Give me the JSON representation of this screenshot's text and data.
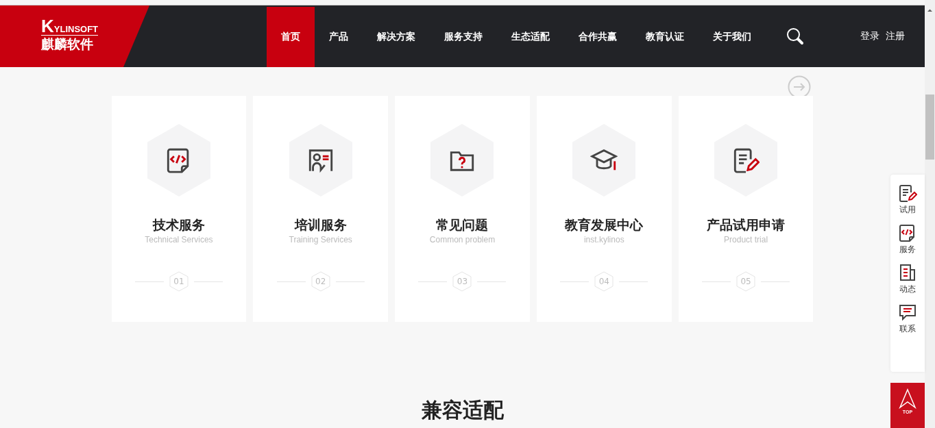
{
  "logo": {
    "wordmark": "KYLINSOFT",
    "name": "麒麟软件"
  },
  "nav": [
    {
      "label": "首页",
      "selected": true
    },
    {
      "label": "产品",
      "selected": false
    },
    {
      "label": "解决方案",
      "selected": false
    },
    {
      "label": "服务支持",
      "selected": false
    },
    {
      "label": "生态适配",
      "selected": false
    },
    {
      "label": "合作共赢",
      "selected": false
    },
    {
      "label": "教育认证",
      "selected": false
    },
    {
      "label": "关于我们",
      "selected": false
    }
  ],
  "account": [
    "登录",
    "注册"
  ],
  "cards": [
    {
      "kind": "code",
      "title": "技术服务",
      "subtitle": "Technical Services",
      "number": "01"
    },
    {
      "kind": "trainer",
      "title": "培训服务",
      "subtitle": "Training Services",
      "number": "02"
    },
    {
      "kind": "question",
      "title": "常见问题",
      "subtitle": "Common problem",
      "number": "03"
    },
    {
      "kind": "education",
      "title": "教育发展中心",
      "subtitle": "inst.kylinos",
      "number": "04"
    },
    {
      "kind": "form",
      "title": "产品试用申请",
      "subtitle": "Product trial",
      "number": "05"
    }
  ],
  "side": [
    {
      "kind": "form",
      "label": "试用"
    },
    {
      "kind": "code",
      "label": "服务"
    },
    {
      "kind": "news",
      "label": "动态"
    },
    {
      "kind": "chat",
      "label": "联系"
    }
  ],
  "top_button": "TOP",
  "section_heading": "兼容适配"
}
